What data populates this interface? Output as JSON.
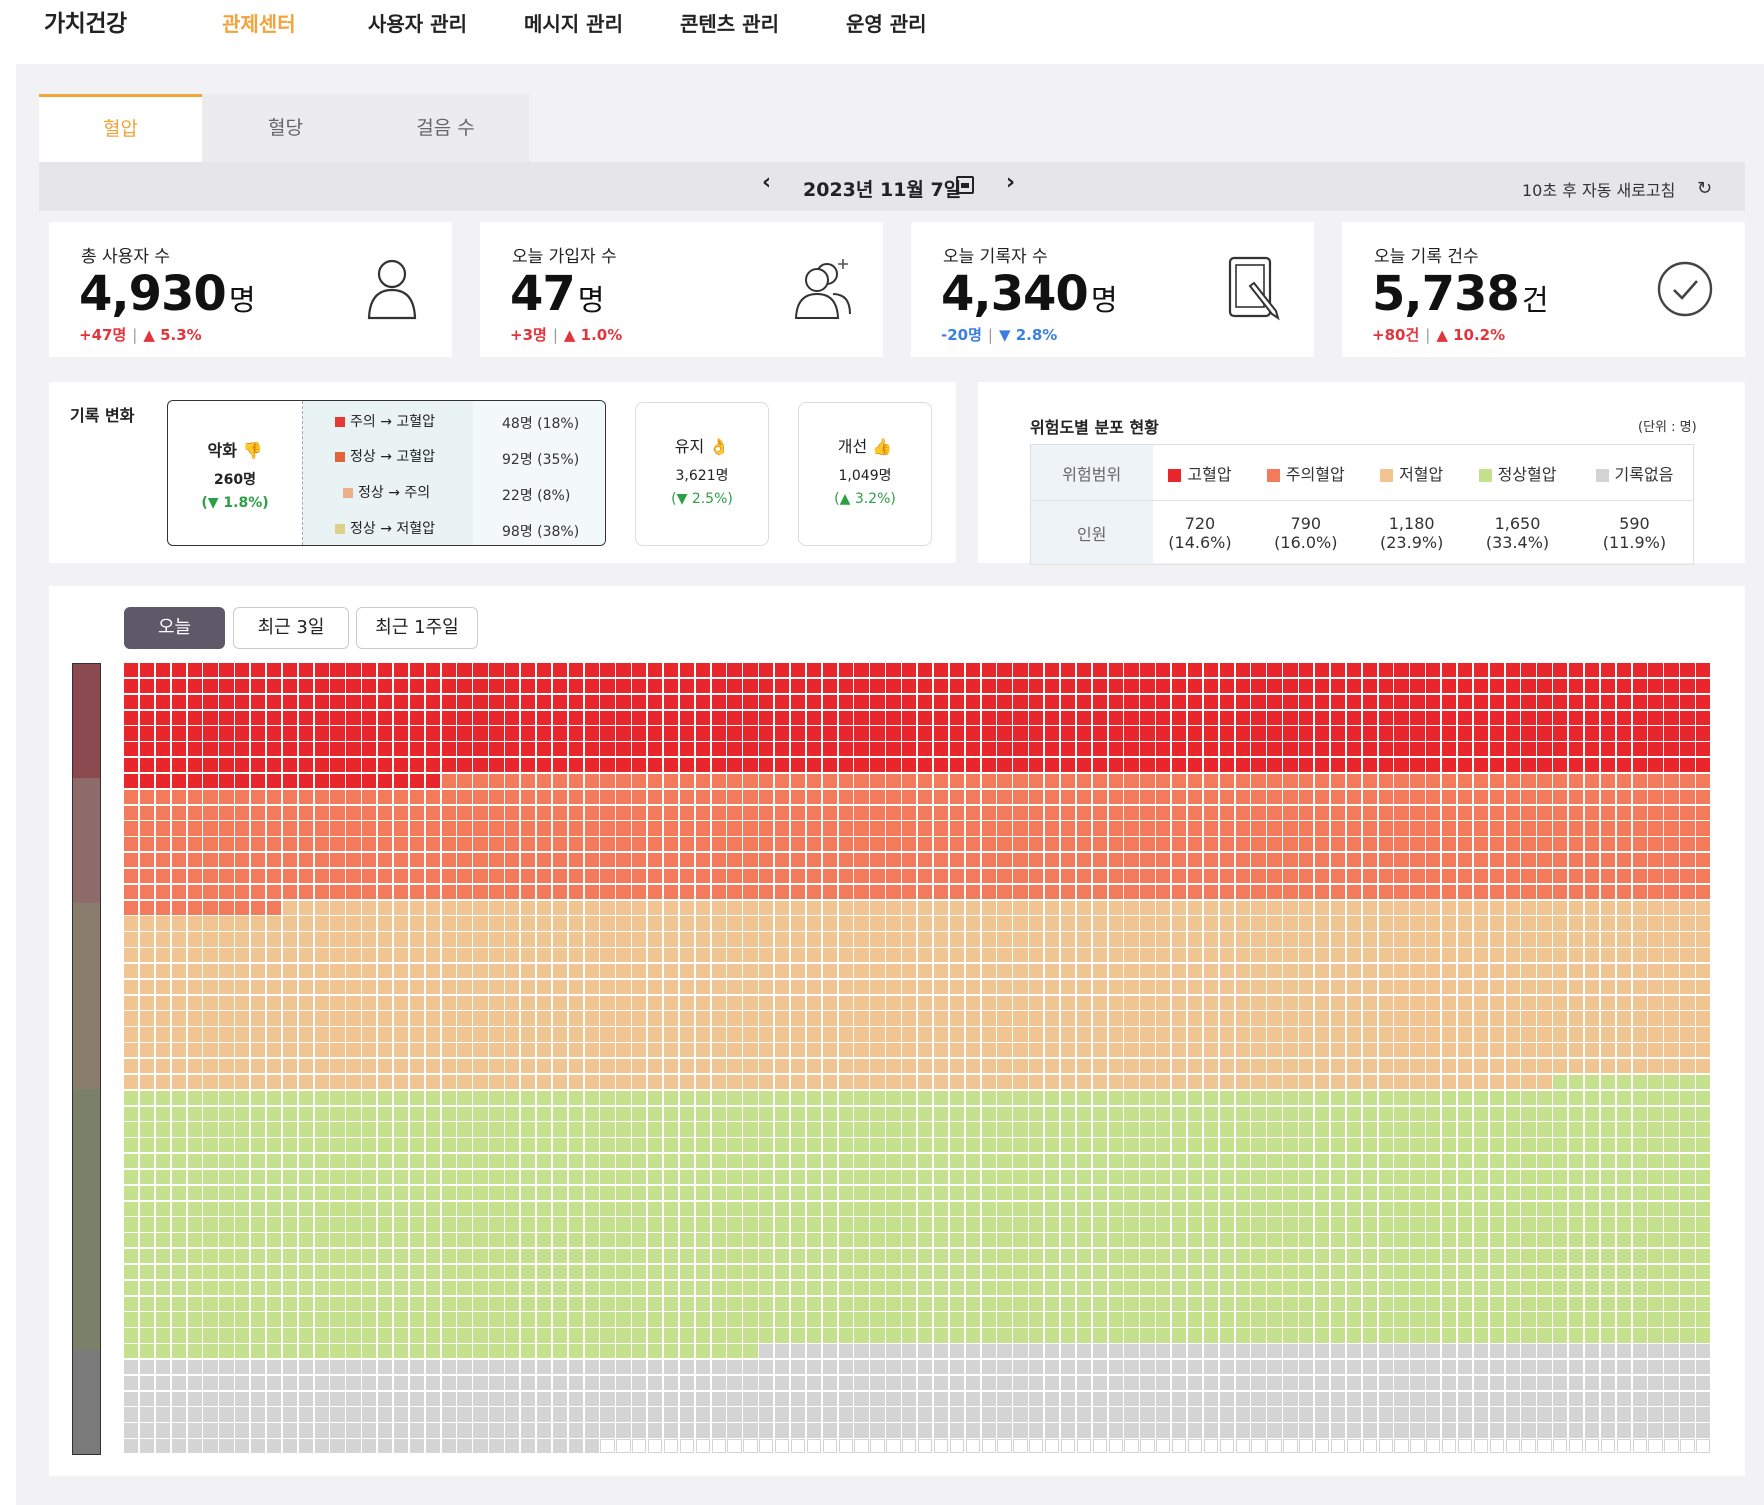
{
  "nav": {
    "brand": "가치건강",
    "items": [
      "관제센터",
      "사용자 관리",
      "메시지 관리",
      "콘텐츠 관리",
      "운영 관리"
    ],
    "active_index": 0
  },
  "tabs": {
    "items": [
      "혈압",
      "혈당",
      "걸음 수"
    ],
    "active_index": 0
  },
  "date_bar": {
    "prev": "‹",
    "date": "2023년 11월 7일",
    "next": "›",
    "refresh_text": "10초 후 자동 새로고침",
    "refresh_icon": "↻"
  },
  "stats": [
    {
      "label": "총 사용자 수",
      "value": "4,930",
      "unit": "명",
      "delta": "+47명",
      "pct": "▲ 5.3%",
      "direction": "up",
      "icon": "user-icon"
    },
    {
      "label": "오늘 가입자 수",
      "value": "47",
      "unit": "명",
      "delta": "+3명",
      "pct": "▲ 1.0%",
      "direction": "up",
      "icon": "user-add-icon"
    },
    {
      "label": "오늘 기록자 수",
      "value": "4,340",
      "unit": "명",
      "delta": "-20명",
      "pct": "▼ 2.8%",
      "direction": "down",
      "icon": "tablet-pen-icon"
    },
    {
      "label": "오늘 기록 건수",
      "value": "5,738",
      "unit": "건",
      "delta": "+80건",
      "pct": "▲ 10.2%",
      "direction": "up",
      "icon": "check-circle-icon"
    }
  ],
  "record_change": {
    "title": "기록 변화",
    "worse": {
      "label": "악화 👎",
      "value": "260명",
      "pct": "(▼ 1.8%)"
    },
    "worse_items": [
      {
        "label": "주의 → 고혈압",
        "value": "48명 (18%)",
        "color": "#e53935"
      },
      {
        "label": "정상 → 고혈압",
        "value": "92명 (35%)",
        "color": "#e0643c"
      },
      {
        "label": "정상 → 주의",
        "value": "22명 (8%)",
        "color": "#eab089"
      },
      {
        "label": "정상 → 저혈압",
        "value": "98명 (38%)",
        "color": "#dcd08a"
      }
    ],
    "maintain": {
      "label": "유지 👌",
      "value": "3,621명",
      "pct": "(▼ 2.5%)"
    },
    "improve": {
      "label": "개선 👍",
      "value": "1,049명",
      "pct": "(▲ 3.2%)"
    }
  },
  "distribution": {
    "title": "위험도별 분포 현황",
    "unit_note": "(단위 : 명)",
    "row_header_1": "위험범위",
    "row_header_2": "인원",
    "categories": [
      {
        "label": "고혈압",
        "count": "720",
        "pct": "(14.6%)",
        "color": "#e8262b"
      },
      {
        "label": "주의혈압",
        "count": "790",
        "pct": "(16.0%)",
        "color": "#f47a5c"
      },
      {
        "label": "저혈압",
        "count": "1,180",
        "pct": "(23.9%)",
        "color": "#f0c591"
      },
      {
        "label": "정상혈압",
        "count": "1,650",
        "pct": "(33.4%)",
        "color": "#c6e18e"
      },
      {
        "label": "기록없음",
        "count": "590",
        "pct": "(11.9%)",
        "color": "#d4d4d4"
      }
    ]
  },
  "waffle": {
    "ranges": [
      "오늘",
      "최근 3일",
      "최근 1주일"
    ],
    "active_range": 0,
    "columns": 100,
    "rows": 50,
    "counts": [
      720,
      790,
      1180,
      1650,
      590
    ],
    "colors": [
      "#e8262b",
      "#f47a5c",
      "#f0c591",
      "#c6e18e",
      "#d4d4d4"
    ],
    "empty_color": "#ffffff",
    "empty_border": "#d4d4d4",
    "side_bar_colors": [
      "#8b4a4f",
      "#8e6a6a",
      "#897d6d",
      "#7b806a",
      "#7a7a7a"
    ]
  }
}
